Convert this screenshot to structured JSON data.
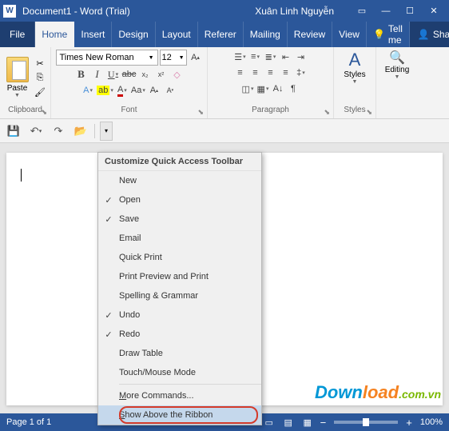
{
  "titlebar": {
    "doc_title": "Document1 - Word (Trial)",
    "user_name": "Xuân Linh Nguyễn"
  },
  "tabs": {
    "file": "File",
    "home": "Home",
    "insert": "Insert",
    "design": "Design",
    "layout": "Layout",
    "references": "Referer",
    "mailings": "Mailing",
    "review": "Review",
    "view": "View",
    "tellme": "Tell me",
    "share": "Share"
  },
  "ribbon": {
    "clipboard": {
      "label": "Clipboard",
      "paste": "Paste"
    },
    "font": {
      "label": "Font",
      "name": "Times New Roman",
      "size": "12"
    },
    "paragraph": {
      "label": "Paragraph"
    },
    "styles": {
      "label": "Styles",
      "button": "Styles"
    },
    "editing": {
      "button": "Editing"
    }
  },
  "qat_menu": {
    "title": "Customize Quick Access Toolbar",
    "items": [
      {
        "label": "New",
        "checked": false
      },
      {
        "label": "Open",
        "checked": true
      },
      {
        "label": "Save",
        "checked": true
      },
      {
        "label": "Email",
        "checked": false
      },
      {
        "label": "Quick Print",
        "checked": false
      },
      {
        "label": "Print Preview and Print",
        "checked": false
      },
      {
        "label": "Spelling & Grammar",
        "checked": false
      },
      {
        "label": "Undo",
        "checked": true
      },
      {
        "label": "Redo",
        "checked": true
      },
      {
        "label": "Draw Table",
        "checked": false
      },
      {
        "label": "Touch/Mouse Mode",
        "checked": false
      }
    ],
    "more_commands_pre": "M",
    "more_commands": "ore Commands...",
    "show_above_pre": "S",
    "show_above": "how Above the Ribbon"
  },
  "status": {
    "page": "Page 1 of 1",
    "zoom": "100%"
  },
  "watermark": {
    "p1": "Down",
    "p2": "load",
    "p3": ".com.vn"
  }
}
